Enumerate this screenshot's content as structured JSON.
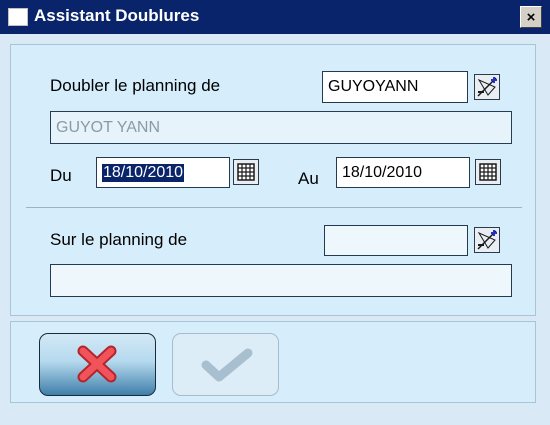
{
  "window": {
    "title": "Assistant Doublures",
    "close_symbol": "×"
  },
  "source": {
    "label": "Doubler le planning de",
    "code_value": "GUYOYANN",
    "name_value": "GUYOT YANN"
  },
  "dates": {
    "from_label": "Du",
    "from_value": "18/10/2010",
    "to_label": "Au",
    "to_value": "18/10/2010"
  },
  "target": {
    "label": "Sur le planning de",
    "code_value": "",
    "name_value": ""
  },
  "buttons": {
    "cancel": "cancel-x-icon",
    "ok": "checkmark-icon"
  },
  "colors": {
    "title_bar": "#09246a",
    "cancel_x": "#e2363d",
    "ok_check_disabled": "#a8bfd0"
  }
}
